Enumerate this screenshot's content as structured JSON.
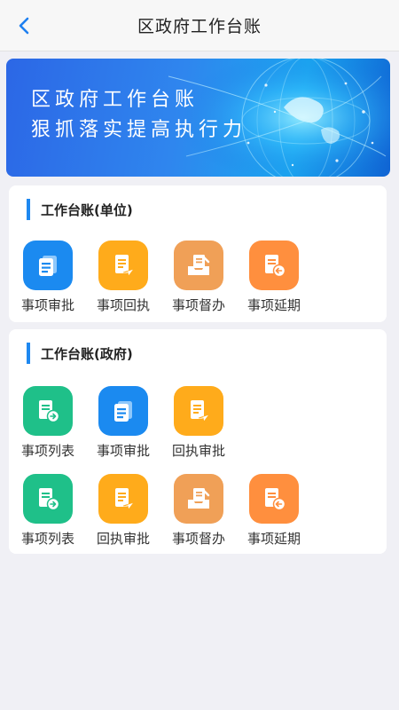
{
  "header": {
    "title": "区政府工作台账"
  },
  "banner": {
    "line1": "区政府工作台账",
    "line2": "狠抓落实提高执行力"
  },
  "unit_section": {
    "title": "工作台账(单位)",
    "items": [
      {
        "label": "事项审批",
        "icon": "doc-stack-icon",
        "color": "#1b8af0"
      },
      {
        "label": "事项回执",
        "icon": "doc-send-icon",
        "color": "#ffab1b"
      },
      {
        "label": "事项督办",
        "icon": "inbox-doc-icon",
        "color": "#f0a057"
      },
      {
        "label": "事项延期",
        "icon": "doc-back-icon",
        "color": "#ff8f3e"
      }
    ]
  },
  "gov_section": {
    "title": "工作台账(政府)",
    "row1": [
      {
        "label": "事项列表",
        "icon": "doc-arrow-icon",
        "color": "#1fc089"
      },
      {
        "label": "事项审批",
        "icon": "doc-stack-icon",
        "color": "#1b8af0"
      },
      {
        "label": "回执审批",
        "icon": "doc-send-icon",
        "color": "#ffab1b"
      }
    ],
    "row2": [
      {
        "label": "事项列表",
        "icon": "doc-arrow-icon",
        "color": "#1fc089"
      },
      {
        "label": "回执审批",
        "icon": "doc-send-icon",
        "color": "#ffab1b"
      },
      {
        "label": "事项督办",
        "icon": "inbox-doc-icon",
        "color": "#f0a057"
      },
      {
        "label": "事项延期",
        "icon": "doc-back-icon",
        "color": "#ff8f3e"
      }
    ]
  }
}
